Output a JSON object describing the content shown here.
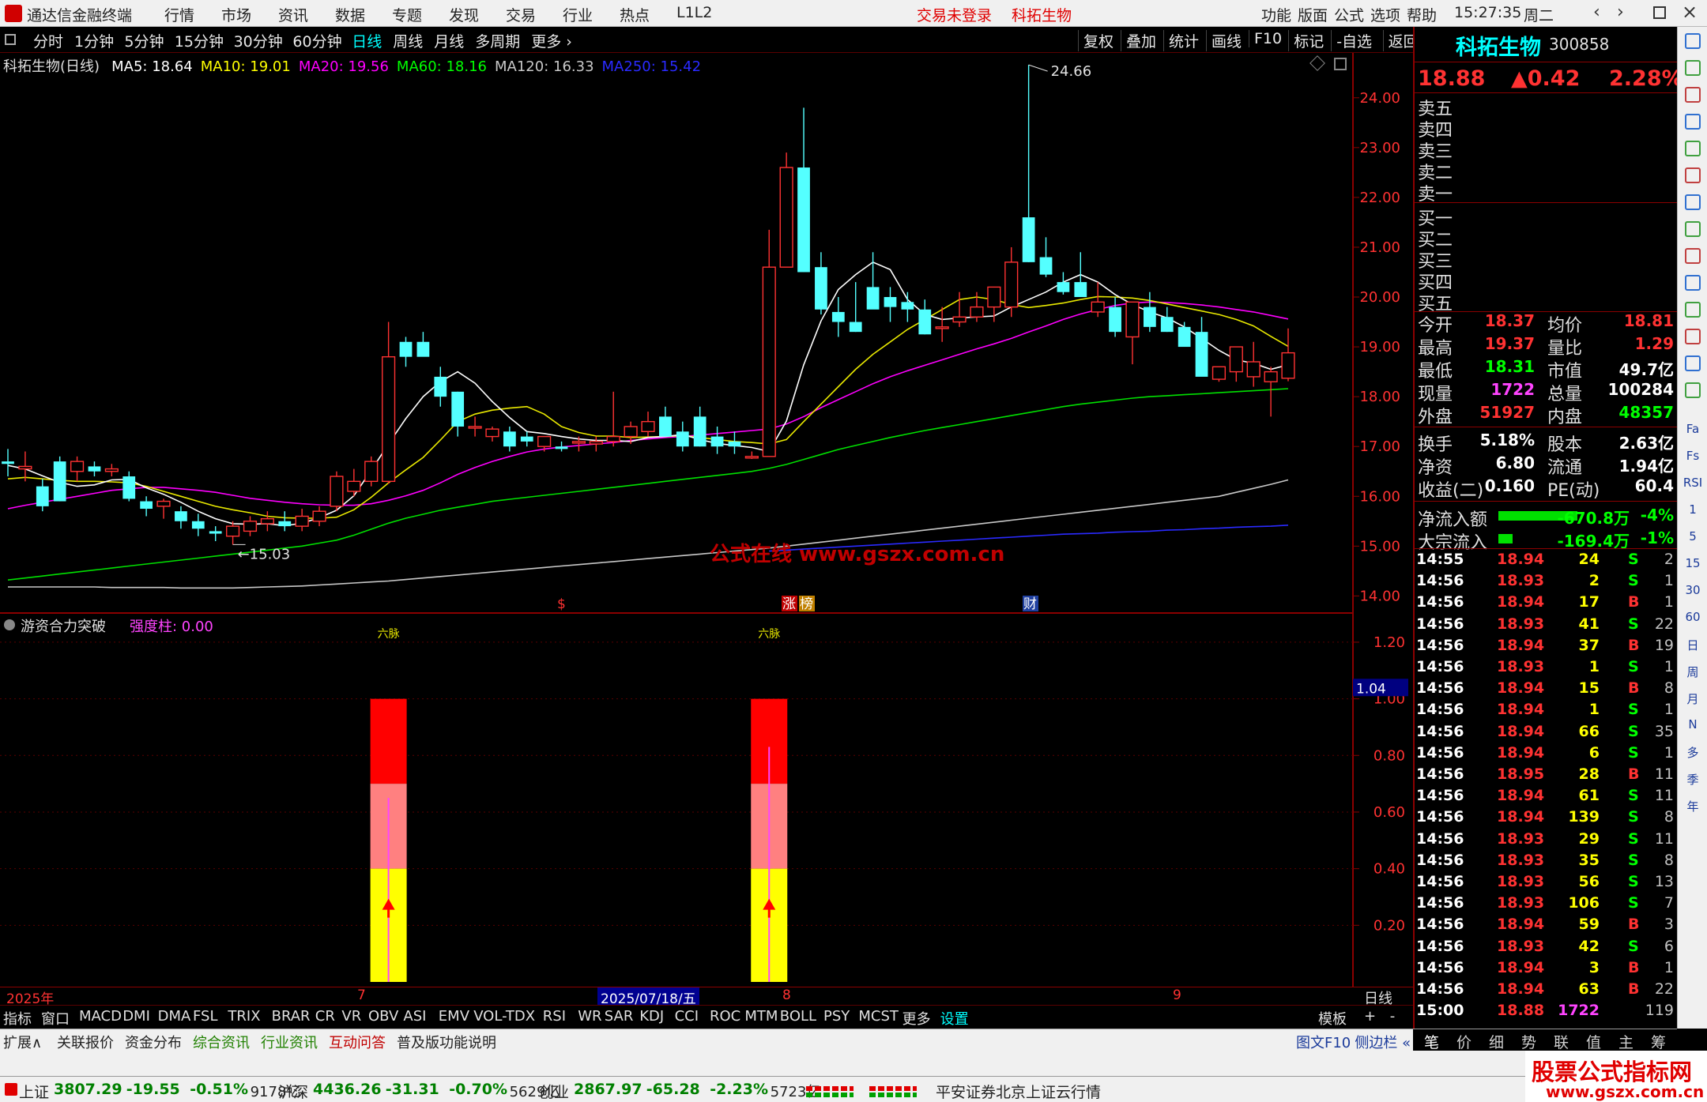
{
  "app": {
    "title": "通达信金融终端",
    "menus": [
      "行情",
      "市场",
      "资讯",
      "数据",
      "专题",
      "发现",
      "交易",
      "行业",
      "热点",
      "L1L2"
    ],
    "trade_status": "交易未登录",
    "stock_title": "科拓生物",
    "right_menus": [
      "功能",
      "版面",
      "公式",
      "选项",
      "帮助"
    ],
    "time": "15:27:35",
    "weekday": "周二"
  },
  "periods": {
    "items": [
      "分时",
      "1分钟",
      "5分钟",
      "15分钟",
      "30分钟",
      "60分钟",
      "日线",
      "周线",
      "月线",
      "多周期",
      "更多"
    ],
    "active": "日线",
    "tools": [
      "复权",
      "叠加",
      "统计",
      "画线",
      "F10",
      "标记",
      "-自选",
      "返回"
    ]
  },
  "chart": {
    "stock_label": "科拓生物(日线)",
    "ma": [
      {
        "label": "MA5: 18.64",
        "color": "#ffffff"
      },
      {
        "label": "MA10: 19.01",
        "color": "#ffff00"
      },
      {
        "label": "MA20: 19.56",
        "color": "#ff00ff"
      },
      {
        "label": "MA60: 18.16",
        "color": "#00ff00"
      },
      {
        "label": "MA120: 16.33",
        "color": "#c8c8c8"
      },
      {
        "label": "MA250: 15.42",
        "color": "#2a2aff"
      }
    ],
    "high_label": "24.66",
    "low_label": "15.03",
    "watermark": "公式在线  www.gszx.com.cn",
    "yticks": [
      "24.00",
      "23.00",
      "22.00",
      "21.00",
      "20.00",
      "19.00",
      "18.00",
      "17.00",
      "16.00",
      "15.00",
      "14.00"
    ],
    "markers": [
      {
        "t": "$"
      },
      {
        "t": "涨"
      },
      {
        "t": "榜"
      },
      {
        "t": "财"
      }
    ]
  },
  "chart_data": {
    "type": "candlestick",
    "ylim": [
      13.8,
      24.9
    ],
    "candles": [
      [
        16.7,
        16.95,
        16.4,
        16.65
      ],
      [
        16.55,
        16.9,
        16.3,
        16.6
      ],
      [
        16.2,
        16.35,
        15.7,
        15.8
      ],
      [
        16.7,
        16.8,
        15.9,
        15.9
      ],
      [
        16.5,
        16.8,
        16.3,
        16.7
      ],
      [
        16.6,
        16.7,
        16.4,
        16.5
      ],
      [
        16.5,
        16.65,
        16.4,
        16.55
      ],
      [
        16.4,
        16.5,
        15.9,
        15.95
      ],
      [
        15.9,
        16.0,
        15.6,
        15.75
      ],
      [
        15.8,
        15.95,
        15.55,
        15.9
      ],
      [
        15.7,
        15.8,
        15.35,
        15.5
      ],
      [
        15.5,
        15.65,
        15.2,
        15.35
      ],
      [
        15.3,
        15.4,
        15.1,
        15.25
      ],
      [
        15.2,
        15.5,
        15.03,
        15.4
      ],
      [
        15.3,
        15.6,
        15.2,
        15.5
      ],
      [
        15.45,
        15.7,
        15.3,
        15.55
      ],
      [
        15.5,
        15.7,
        15.3,
        15.4
      ],
      [
        15.4,
        15.75,
        15.3,
        15.6
      ],
      [
        15.5,
        15.8,
        15.4,
        15.7
      ],
      [
        15.8,
        16.5,
        15.7,
        16.4
      ],
      [
        16.1,
        16.55,
        16.0,
        16.3
      ],
      [
        16.3,
        16.8,
        16.2,
        16.7
      ],
      [
        16.3,
        19.5,
        16.25,
        18.8
      ],
      [
        19.1,
        19.2,
        18.6,
        18.8
      ],
      [
        19.1,
        19.3,
        18.9,
        18.8
      ],
      [
        18.4,
        18.6,
        17.8,
        18.0
      ],
      [
        18.1,
        18.1,
        17.2,
        17.4
      ],
      [
        17.4,
        17.6,
        17.2,
        17.4
      ],
      [
        17.2,
        17.4,
        17.1,
        17.35
      ],
      [
        17.3,
        17.4,
        16.9,
        17.0
      ],
      [
        17.2,
        17.3,
        17.0,
        17.1
      ],
      [
        17.0,
        17.2,
        16.9,
        17.2
      ],
      [
        17.0,
        17.1,
        16.9,
        16.95
      ],
      [
        17.1,
        17.2,
        16.9,
        17.1
      ],
      [
        17.05,
        17.2,
        16.9,
        17.1
      ],
      [
        17.1,
        18.1,
        17.0,
        17.2
      ],
      [
        17.2,
        17.5,
        17.05,
        17.4
      ],
      [
        17.3,
        17.7,
        17.2,
        17.5
      ],
      [
        17.6,
        17.8,
        17.2,
        17.2
      ],
      [
        17.3,
        17.5,
        16.9,
        17.0
      ],
      [
        17.6,
        17.8,
        17.0,
        17.0
      ],
      [
        17.2,
        17.4,
        16.85,
        17.0
      ],
      [
        17.1,
        17.3,
        16.85,
        17.0
      ],
      [
        16.8,
        16.9,
        16.75,
        16.8
      ],
      [
        16.8,
        21.35,
        16.8,
        20.6
      ],
      [
        20.6,
        22.9,
        20.6,
        22.6
      ],
      [
        22.6,
        23.8,
        20.5,
        20.5
      ],
      [
        20.6,
        20.9,
        19.65,
        19.75
      ],
      [
        19.7,
        20.0,
        19.2,
        19.5
      ],
      [
        19.5,
        20.3,
        19.3,
        19.3
      ],
      [
        20.2,
        20.9,
        19.8,
        19.75
      ],
      [
        20.0,
        20.2,
        19.5,
        19.8
      ],
      [
        19.9,
        20.1,
        19.5,
        19.75
      ],
      [
        19.75,
        19.95,
        19.25,
        19.25
      ],
      [
        19.4,
        19.8,
        19.1,
        19.4
      ],
      [
        19.5,
        20.1,
        19.4,
        19.6
      ],
      [
        19.6,
        20.1,
        19.5,
        19.8
      ],
      [
        19.8,
        20.2,
        19.5,
        20.2
      ],
      [
        19.8,
        21.0,
        19.6,
        20.7
      ],
      [
        21.6,
        24.66,
        20.7,
        20.7
      ],
      [
        20.8,
        21.2,
        20.4,
        20.45
      ],
      [
        20.3,
        20.5,
        20.05,
        20.1
      ],
      [
        20.3,
        20.9,
        20.05,
        20.0
      ],
      [
        19.7,
        20.3,
        19.6,
        19.9
      ],
      [
        19.8,
        20.0,
        19.2,
        19.3
      ],
      [
        19.2,
        19.9,
        18.65,
        19.9
      ],
      [
        19.8,
        20.1,
        19.3,
        19.4
      ],
      [
        19.6,
        19.8,
        19.3,
        19.3
      ],
      [
        19.4,
        19.5,
        19.1,
        19.0
      ],
      [
        19.3,
        19.6,
        18.9,
        18.4
      ],
      [
        18.35,
        18.6,
        18.3,
        18.6
      ],
      [
        18.5,
        19.0,
        18.3,
        19.0
      ],
      [
        18.4,
        19.1,
        18.2,
        18.7
      ],
      [
        18.3,
        18.6,
        17.6,
        18.5
      ],
      [
        18.37,
        19.37,
        18.31,
        18.88
      ]
    ],
    "ma5": [
      16.62,
      16.55,
      16.41,
      16.28,
      16.2,
      16.23,
      16.33,
      16.34,
      16.17,
      16.04,
      15.88,
      15.7,
      15.55,
      15.45,
      15.44,
      15.45,
      15.41,
      15.46,
      15.57,
      15.72,
      16.01,
      16.52,
      17.05,
      17.56,
      18.0,
      18.3,
      18.5,
      18.27,
      17.9,
      17.58,
      17.3,
      17.26,
      17.2,
      17.15,
      17.12,
      17.12,
      17.1,
      17.18,
      17.2,
      17.24,
      17.14,
      17.06,
      17.02,
      16.98,
      16.9,
      17.51,
      18.64,
      19.52,
      20.15,
      20.45,
      20.7,
      20.55,
      19.95,
      19.65,
      19.55,
      19.58,
      19.6,
      19.62,
      19.8,
      19.95,
      20.1,
      20.3,
      20.45,
      20.3,
      20.05,
      19.85,
      19.7,
      19.58,
      19.4,
      19.17,
      18.93,
      18.74,
      18.67,
      18.55,
      18.64
    ],
    "ma10": [
      16.35,
      16.38,
      16.35,
      16.32,
      16.3,
      16.3,
      16.29,
      16.27,
      16.2,
      16.1,
      16.0,
      15.9,
      15.8,
      15.73,
      15.67,
      15.6,
      15.57,
      15.56,
      15.56,
      15.58,
      15.73,
      15.98,
      16.27,
      16.53,
      16.78,
      17.13,
      17.5,
      17.65,
      17.73,
      17.77,
      17.8,
      17.65,
      17.4,
      17.28,
      17.21,
      17.21,
      17.18,
      17.19,
      17.2,
      17.22,
      17.18,
      17.14,
      17.1,
      17.08,
      17.05,
      17.14,
      17.5,
      17.85,
      18.2,
      18.55,
      18.85,
      19.1,
      19.35,
      19.55,
      19.75,
      19.95,
      20.0,
      19.95,
      19.85,
      19.79,
      19.83,
      19.88,
      19.95,
      20.01,
      20.0,
      19.98,
      19.93,
      19.86,
      19.79,
      19.72,
      19.65,
      19.55,
      19.42,
      19.21,
      19.01
    ],
    "ma20": [
      15.75,
      15.82,
      15.88,
      15.94,
      16.0,
      16.06,
      16.12,
      16.15,
      16.18,
      16.18,
      16.15,
      16.12,
      16.08,
      16.02,
      15.96,
      15.92,
      15.88,
      15.85,
      15.83,
      15.82,
      15.82,
      15.85,
      15.92,
      16.01,
      16.12,
      16.27,
      16.44,
      16.58,
      16.7,
      16.8,
      16.89,
      16.95,
      16.99,
      17.02,
      17.05,
      17.08,
      17.12,
      17.15,
      17.18,
      17.2,
      17.23,
      17.26,
      17.29,
      17.32,
      17.35,
      17.45,
      17.6,
      17.78,
      17.94,
      18.1,
      18.26,
      18.4,
      18.52,
      18.63,
      18.74,
      18.85,
      18.96,
      19.06,
      19.17,
      19.3,
      19.42,
      19.55,
      19.66,
      19.75,
      19.83,
      19.88,
      19.9,
      19.89,
      19.87,
      19.84,
      19.8,
      19.75,
      19.7,
      19.63,
      19.56
    ],
    "ma60": [
      14.32,
      14.36,
      14.4,
      14.44,
      14.48,
      14.52,
      14.56,
      14.6,
      14.64,
      14.68,
      14.72,
      14.76,
      14.8,
      14.84,
      14.88,
      14.92,
      14.96,
      15.0,
      15.06,
      15.12,
      15.22,
      15.34,
      15.46,
      15.56,
      15.64,
      15.72,
      15.78,
      15.84,
      15.9,
      15.94,
      15.98,
      16.02,
      16.06,
      16.1,
      16.14,
      16.18,
      16.22,
      16.26,
      16.3,
      16.34,
      16.38,
      16.42,
      16.46,
      16.5,
      16.56,
      16.64,
      16.74,
      16.84,
      16.94,
      17.02,
      17.1,
      17.18,
      17.25,
      17.32,
      17.38,
      17.44,
      17.5,
      17.56,
      17.62,
      17.68,
      17.74,
      17.8,
      17.85,
      17.89,
      17.93,
      17.97,
      18.0,
      18.02,
      18.04,
      18.06,
      18.08,
      18.1,
      18.12,
      18.14,
      18.16
    ],
    "ma120": [
      14.18,
      14.18,
      14.18,
      14.18,
      14.18,
      14.18,
      14.17,
      14.17,
      14.17,
      14.17,
      14.16,
      14.16,
      14.16,
      14.16,
      14.17,
      14.18,
      14.19,
      14.2,
      14.22,
      14.24,
      14.26,
      14.28,
      14.3,
      14.33,
      14.36,
      14.39,
      14.42,
      14.45,
      14.48,
      14.51,
      14.54,
      14.57,
      14.6,
      14.63,
      14.66,
      14.69,
      14.72,
      14.75,
      14.78,
      14.81,
      14.84,
      14.87,
      14.9,
      14.93,
      14.96,
      15.0,
      15.04,
      15.08,
      15.12,
      15.16,
      15.2,
      15.24,
      15.28,
      15.32,
      15.36,
      15.4,
      15.44,
      15.48,
      15.52,
      15.56,
      15.6,
      15.64,
      15.68,
      15.72,
      15.76,
      15.8,
      15.84,
      15.88,
      15.92,
      15.96,
      16.0,
      16.08,
      16.16,
      16.24,
      16.33
    ],
    "ma250": [
      null,
      null,
      null,
      null,
      null,
      null,
      null,
      null,
      null,
      null,
      null,
      null,
      null,
      null,
      null,
      null,
      null,
      null,
      null,
      null,
      null,
      null,
      null,
      null,
      null,
      null,
      null,
      null,
      null,
      null,
      null,
      null,
      null,
      null,
      null,
      null,
      null,
      null,
      null,
      null,
      null,
      null,
      null,
      null,
      14.9,
      14.92,
      14.94,
      14.96,
      14.98,
      15.0,
      15.02,
      15.04,
      15.06,
      15.08,
      15.1,
      15.12,
      15.14,
      15.16,
      15.18,
      15.2,
      15.22,
      15.24,
      15.25,
      15.26,
      15.28,
      15.29,
      15.3,
      15.32,
      15.33,
      15.35,
      15.36,
      15.38,
      15.39,
      15.4,
      15.42
    ],
    "signal_bars": [
      {
        "index": 22,
        "value": 1.0,
        "line": 0.65,
        "label": "六脉"
      },
      {
        "index": 44,
        "value": 1.0,
        "line": 0.83,
        "label": "六脉"
      }
    ],
    "ind_yticks": [
      "1.20",
      "1.00",
      "0.80",
      "0.60",
      "0.40",
      "0.20"
    ],
    "ind_ylim": [
      0,
      1.25
    ],
    "ind_value_box": "1.04"
  },
  "indicator": {
    "name": "游资合力突破",
    "strength": "强度柱: 0.00"
  },
  "date_axis": {
    "labels": [
      {
        "t": "2025年"
      },
      {
        "t": "7"
      },
      {
        "t": "2025/07/18/五",
        "hl": true
      },
      {
        "t": "8"
      },
      {
        "t": "9"
      }
    ],
    "period": "日线"
  },
  "tabs": [
    "指标",
    "窗口",
    "MACD",
    "DMI",
    "DMA",
    "FSL",
    "TRIX",
    "BRAR",
    "CR",
    "VR",
    "OBV",
    "ASI",
    "EMV",
    "VOL-TDX",
    "RSI",
    "WR",
    "SAR",
    "KDJ",
    "CCI",
    "ROC",
    "MTM",
    "BOLL",
    "PSY",
    "MCST",
    "更多",
    "设置"
  ],
  "tabs_right": [
    "模板",
    "+",
    "-"
  ],
  "ext_tabs": [
    "扩展∧",
    "关联报价",
    "资金分布",
    "综合资讯",
    "行业资讯",
    "互动问答",
    "普及版功能说明"
  ],
  "ext_right": [
    "图文F10",
    "侧边栏 «"
  ],
  "bottom_tabs": [
    "笔",
    "价",
    "细",
    "势",
    "联",
    "值",
    "主",
    "筹"
  ],
  "quote": {
    "name": "科拓生物",
    "code": "300858",
    "price": "18.88",
    "change": "▲0.42",
    "pct": "2.28%",
    "sells": [
      "卖五",
      "卖四",
      "卖三",
      "卖二",
      "卖一"
    ],
    "buys": [
      "买一",
      "买二",
      "买三",
      "买四",
      "买五"
    ],
    "stats": [
      [
        "今开",
        "18.37",
        "均价",
        "18.81"
      ],
      [
        "最高",
        "19.37",
        "量比",
        "1.29"
      ],
      [
        "最低",
        "18.31",
        "市值",
        "49.7亿"
      ],
      [
        "现量",
        "1722",
        "总量",
        "100284"
      ],
      [
        "外盘",
        "51927",
        "内盘",
        "48357"
      ],
      [
        "换手",
        "5.18%",
        "股本",
        "2.63亿"
      ],
      [
        "净资",
        "6.80",
        "流通",
        "1.94亿"
      ],
      [
        "收益(二)",
        "0.160",
        "PE(动)",
        "60.4"
      ]
    ],
    "flows": [
      [
        "净流入额",
        "-670.8万",
        "-4%"
      ],
      [
        "大宗流入",
        "-169.4万",
        "-1%"
      ]
    ]
  },
  "ticks": [
    [
      "14:55",
      "18.94",
      "24",
      "S",
      "2"
    ],
    [
      "14:56",
      "18.93",
      "2",
      "S",
      "1"
    ],
    [
      "14:56",
      "18.94",
      "17",
      "B",
      "1"
    ],
    [
      "14:56",
      "18.93",
      "41",
      "S",
      "22"
    ],
    [
      "14:56",
      "18.94",
      "37",
      "B",
      "19"
    ],
    [
      "14:56",
      "18.93",
      "1",
      "S",
      "1"
    ],
    [
      "14:56",
      "18.94",
      "15",
      "B",
      "8"
    ],
    [
      "14:56",
      "18.94",
      "1",
      "S",
      "1"
    ],
    [
      "14:56",
      "18.94",
      "66",
      "S",
      "35"
    ],
    [
      "14:56",
      "18.94",
      "6",
      "S",
      "1"
    ],
    [
      "14:56",
      "18.95",
      "28",
      "B",
      "11"
    ],
    [
      "14:56",
      "18.94",
      "61",
      "S",
      "11"
    ],
    [
      "14:56",
      "18.94",
      "139",
      "S",
      "8"
    ],
    [
      "14:56",
      "18.93",
      "29",
      "S",
      "11"
    ],
    [
      "14:56",
      "18.93",
      "35",
      "S",
      "8"
    ],
    [
      "14:56",
      "18.93",
      "56",
      "S",
      "13"
    ],
    [
      "14:56",
      "18.93",
      "106",
      "S",
      "7"
    ],
    [
      "14:56",
      "18.94",
      "59",
      "B",
      "3"
    ],
    [
      "14:56",
      "18.93",
      "42",
      "S",
      "6"
    ],
    [
      "14:56",
      "18.94",
      "3",
      "B",
      "1"
    ],
    [
      "14:56",
      "18.94",
      "63",
      "B",
      "22"
    ],
    [
      "15:00",
      "18.88",
      "1722",
      "",
      "119"
    ]
  ],
  "side_icons": [
    "Fa",
    "Fs",
    "RSI",
    "1",
    "5",
    "15",
    "30",
    "60",
    "日",
    "周",
    "月",
    "N",
    "多",
    "季",
    "年"
  ],
  "status": {
    "indices": [
      [
        "上证",
        "3807.29",
        "-19.55",
        "-0.51%",
        "9178亿"
      ],
      [
        "沪深",
        "4436.26",
        "-31.31",
        "-0.70%",
        "5629亿"
      ],
      [
        "创业",
        "2867.97",
        "-65.28",
        "-2.23%",
        "5723亿"
      ]
    ],
    "broker": "平安证券北京上证云行情",
    "brand": "股票公式指标网",
    "brand_url": "www.gszx.com.cn"
  }
}
